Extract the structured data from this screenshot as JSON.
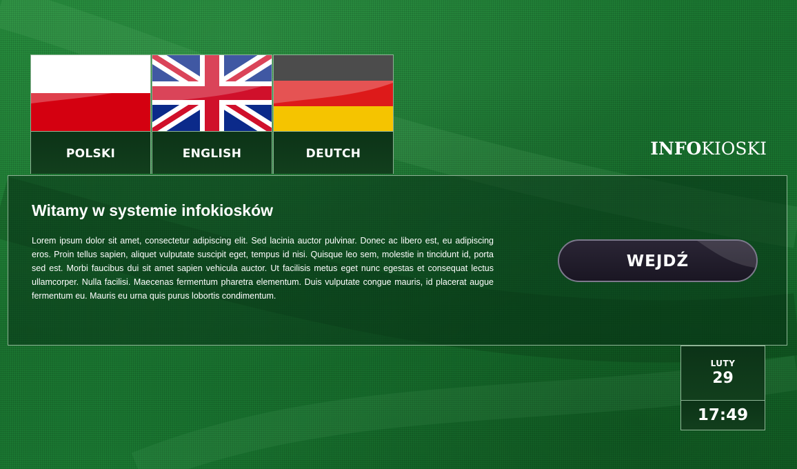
{
  "logo": {
    "part_bold": "INFO",
    "part_regular": "KIOSKI"
  },
  "languages": [
    {
      "label": "POLSKI",
      "flag": "poland-flag-icon"
    },
    {
      "label": "ENGLISH",
      "flag": "uk-flag-icon"
    },
    {
      "label": "DEUTCH",
      "flag": "germany-flag-icon"
    }
  ],
  "welcome": {
    "title": "Witamy w systemie infokiosków",
    "body": "Lorem ipsum dolor sit amet, consectetur adipiscing elit. Sed lacinia auctor pulvinar. Donec ac libero est, eu adipiscing eros. Proin tellus sapien, aliquet vulputate suscipit eget, tempus id nisi. Quisque leo sem, molestie in tincidunt id, porta sed est. Morbi faucibus dui sit amet sapien vehicula auctor. Ut facilisis metus eget nunc egestas et consequat lectus ullamcorper. Nulla facilisi. Maecenas fermentum pharetra elementum. Duis vulputate congue mauris, id placerat augue fermentum eu. Mauris eu urna quis purus lobortis condimentum.",
    "enter_button": "WEJDŹ"
  },
  "clock": {
    "month": "LUTY",
    "day": "29",
    "time": "17:49"
  },
  "colors": {
    "background": "#1d7a33",
    "panel_border": "#8fb596",
    "button": "#1f1b29"
  }
}
